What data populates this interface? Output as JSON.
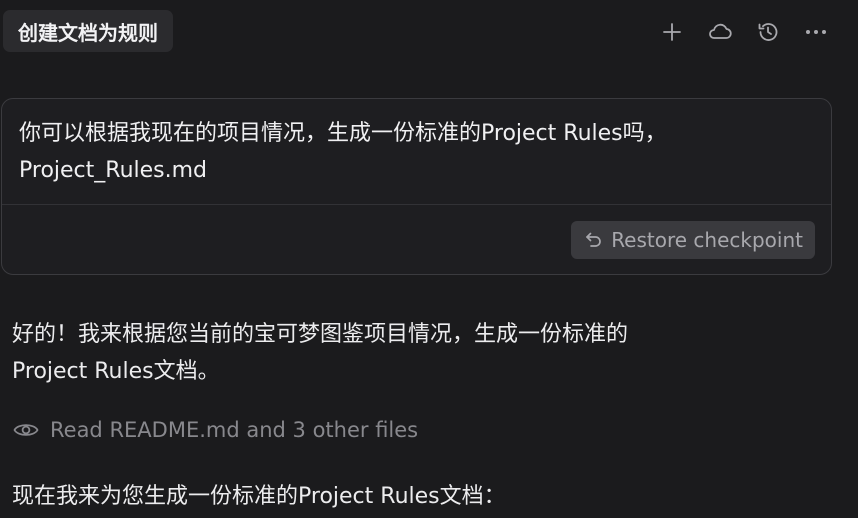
{
  "header": {
    "title": "创建文档为规则",
    "actions": [
      {
        "icon": "plus-icon"
      },
      {
        "icon": "cloud-icon"
      },
      {
        "icon": "history-icon"
      },
      {
        "icon": "more-icon"
      }
    ]
  },
  "user_message": {
    "text": "你可以根据我现在的项目情况，生成一份标准的Project Rules吗，\nProject_Rules.md",
    "restore_label": "Restore checkpoint",
    "restore_icon": "undo-icon"
  },
  "assistant": {
    "reply_text": "好的！我来根据您当前的宝可梦图鉴项目情况，生成一份标准的\nProject Rules文档。",
    "files_read_label": "Read README.md and 3 other files",
    "files_read_icon": "eye-icon",
    "followup_text": "现在我来为您生成一份标准的Project Rules文档："
  },
  "colors": {
    "background": "#1b1b1d",
    "card_border": "#3b3b3f",
    "muted_text": "#88888d"
  }
}
